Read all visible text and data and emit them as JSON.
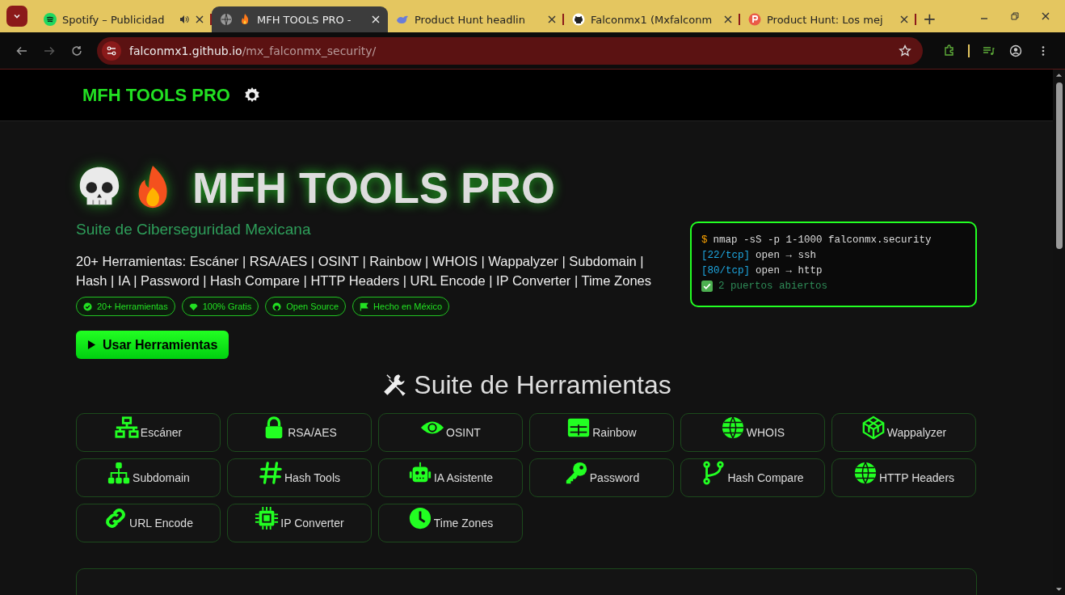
{
  "browser": {
    "tabs": [
      {
        "title": "Spotify – Publicidad",
        "selected": false,
        "audio": true
      },
      {
        "title": "MFH TOOLS PRO -",
        "selected": true,
        "audio": false
      },
      {
        "title": "Product Hunt headlin",
        "selected": false,
        "audio": false
      },
      {
        "title": "Falconmx1 (Mxfalconm",
        "selected": false,
        "audio": false
      },
      {
        "title": "Product Hunt: Los mej",
        "selected": false,
        "audio": false
      }
    ],
    "new_tab": "+",
    "url": {
      "host": "falconmx1.github.io",
      "path": "/mx_falconmx_security/"
    }
  },
  "header": {
    "brand": "MFH TOOLS PRO"
  },
  "hero": {
    "title": "MFH TOOLS PRO",
    "subtitle": "Suite de Ciberseguridad Mexicana",
    "description": "20+ Herramientas: Escáner | RSA/AES | OSINT | Rainbow | WHOIS | Wappalyzer | Subdomain | Hash | IA | Password | Hash Compare | HTTP Headers | URL Encode | IP Converter | Time Zones",
    "badges": [
      "20+ Herramientas",
      "100% Gratis",
      "Open Source",
      "Hecho en México"
    ],
    "button": "Usar Herramientas"
  },
  "terminal": {
    "lines": [
      {
        "kind": "command",
        "prefix": "$",
        "text": "nmap -sS -p 1-1000 falconmx.security"
      },
      {
        "kind": "port",
        "prefix": "[22/tcp]",
        "text": "open → ssh"
      },
      {
        "kind": "port",
        "prefix": "[80/tcp]",
        "text": "open → http"
      },
      {
        "kind": "result",
        "text": "2 puertos abiertos"
      }
    ]
  },
  "tools": {
    "title": "Suite de Herramientas",
    "items": [
      "Escáner",
      "RSA/AES",
      "OSINT",
      "Rainbow",
      "WHOIS",
      "Wappalyzer",
      "Subdomain",
      "Hash Tools",
      "IA Asistente",
      "Password",
      "Hash Compare",
      "HTTP Headers",
      "URL Encode",
      "IP Converter",
      "Time Zones"
    ]
  }
}
